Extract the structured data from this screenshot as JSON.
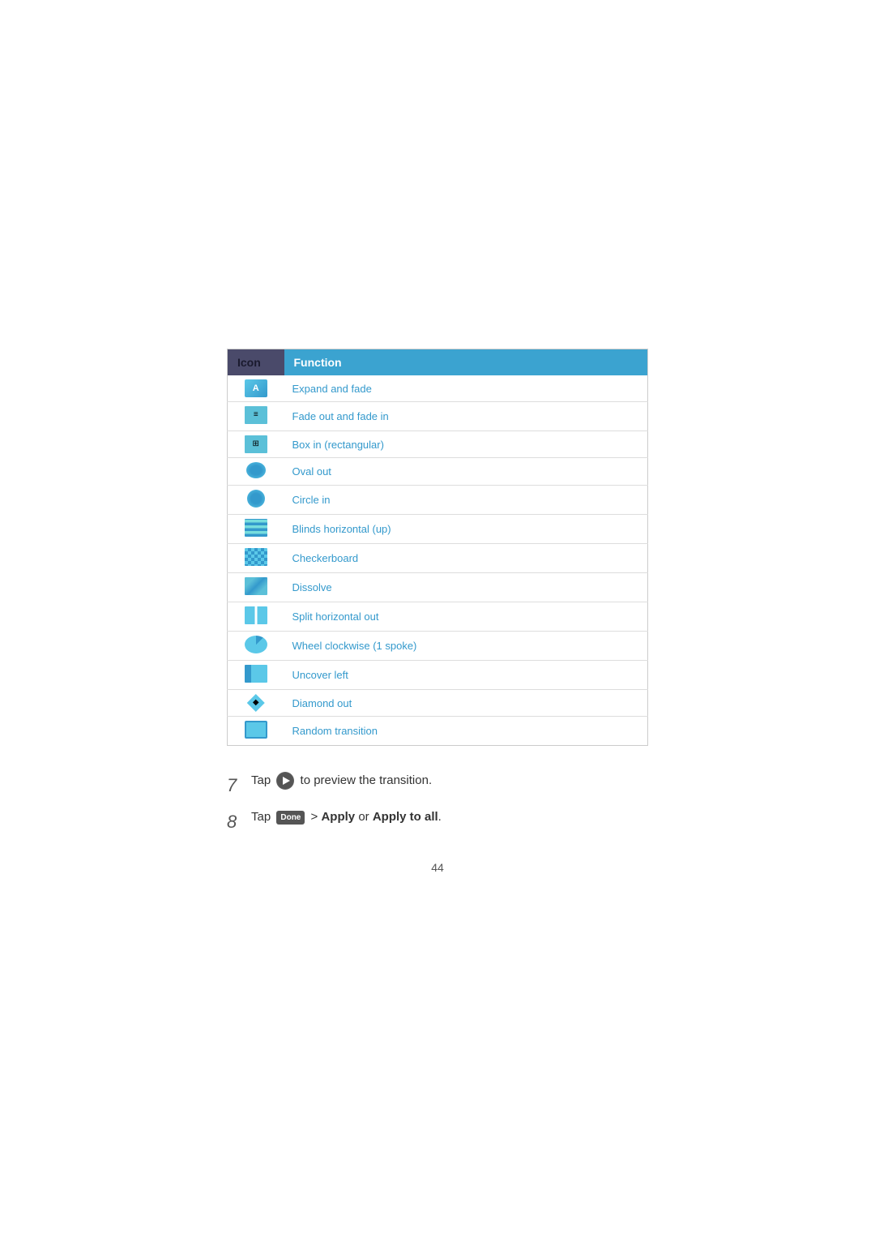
{
  "table": {
    "col_icon": "Icon",
    "col_function": "Function",
    "rows": [
      {
        "id": "expand-fade",
        "icon_type": "ico-a",
        "icon_label": "A",
        "function": "Expand and fade"
      },
      {
        "id": "fade-out-fade",
        "icon_type": "ico-bars",
        "icon_label": "≡",
        "function": "Fade out and fade in"
      },
      {
        "id": "box-in",
        "icon_type": "ico-grid",
        "icon_label": "⊞",
        "function": "Box in (rectangular)"
      },
      {
        "id": "oval-out",
        "icon_type": "ico-oval",
        "icon_label": "",
        "function": "Oval out"
      },
      {
        "id": "circle-in",
        "icon_type": "ico-circle",
        "icon_label": "",
        "function": "Circle in"
      },
      {
        "id": "blinds-horizontal",
        "icon_type": "ico-stripes",
        "icon_label": "",
        "function": "Blinds horizontal (up)"
      },
      {
        "id": "checkerboard",
        "icon_type": "ico-checker",
        "icon_label": "",
        "function": "Checkerboard"
      },
      {
        "id": "dissolve",
        "icon_type": "ico-dissolve",
        "icon_label": "",
        "function": "Dissolve"
      },
      {
        "id": "split-horizontal",
        "icon_type": "ico-split",
        "icon_label": "",
        "function": "Split horizontal out"
      },
      {
        "id": "wheel-clockwise",
        "icon_type": "ico-wheel",
        "icon_label": "",
        "function": "Wheel clockwise (1 spoke)"
      },
      {
        "id": "uncover-left",
        "icon_type": "ico-uncover",
        "icon_label": "",
        "function": "Uncover left"
      },
      {
        "id": "diamond-out",
        "icon_type": "ico-diamond",
        "icon_label": "◆",
        "function": "Diamond out"
      },
      {
        "id": "random-transition",
        "icon_type": "ico-random",
        "icon_label": "",
        "function": "Random transition"
      }
    ]
  },
  "steps": {
    "step7": {
      "number": "7",
      "text_before": "Tap",
      "text_after": "to preview the transition."
    },
    "step8": {
      "number": "8",
      "text_before": "Tap",
      "button_label": "Done",
      "text_middle": " > ",
      "apply_label": "Apply",
      "or_text": " or ",
      "apply_all_label": "Apply to all",
      "period": "."
    }
  },
  "page_number": "44"
}
